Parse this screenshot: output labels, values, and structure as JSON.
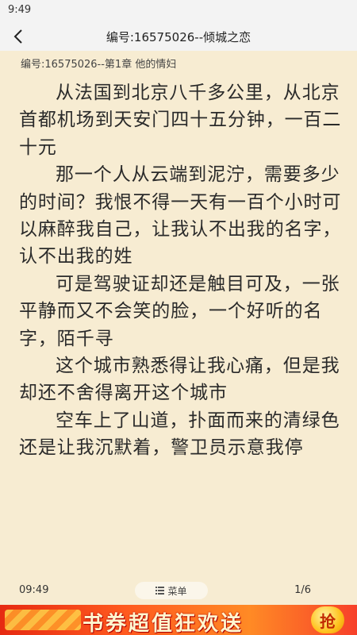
{
  "status_bar": {
    "time": "9:49"
  },
  "header": {
    "back_icon": "chevron-left-icon",
    "title": "编号:16575026--倾城之恋"
  },
  "chapter": {
    "title": "编号:16575026--第1章 他的情妇"
  },
  "content": {
    "paragraphs": [
      "从法国到北京八千多公里，从北京首都机场到天安门四十五分钟，一百二十元",
      "那一个人从云端到泥泞，需要多少的时间？我恨不得一天有一百个小时可以麻醉我自己，让我认不出我的名字，认不出我的姓",
      "可是驾驶证却还是触目可及，一张平静而又不会笑的脸，一个好听的名字，陌千寻",
      "这个城市熟悉得让我心痛，但是我却还不舍得离开这个城市",
      "空车上了山道，扑面而来的清绿色还是让我沉默着，警卫员示意我停"
    ]
  },
  "footer": {
    "time": "09:49",
    "menu_icon": "list-menu-icon",
    "menu_label": "菜单",
    "page": "1/6"
  },
  "ad": {
    "text": "书券超值狂欢送",
    "button": "抢",
    "colors": {
      "primary": "#e62a12",
      "secondary": "#ff8a25",
      "text": "#fff7d0"
    }
  }
}
